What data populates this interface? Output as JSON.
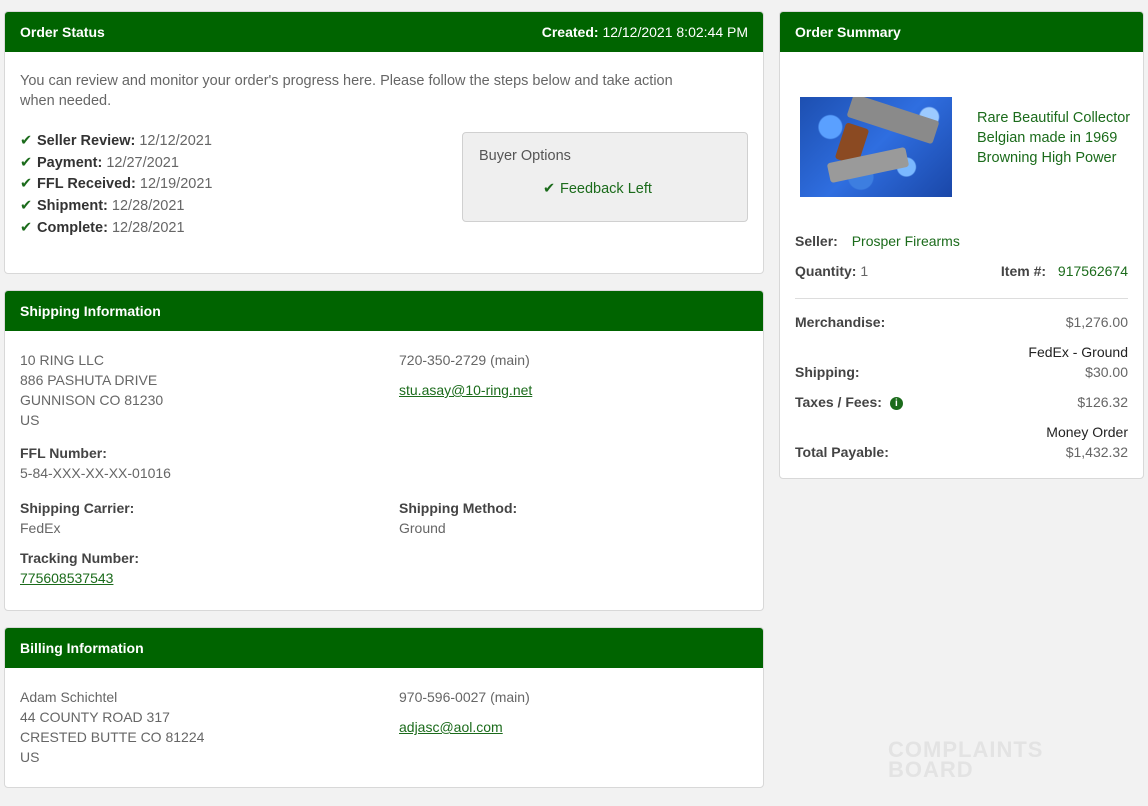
{
  "order_status": {
    "title": "Order Status",
    "created_label": "Created:",
    "created_value": "12/12/2021 8:02:44 PM",
    "intro": "You can review and monitor your order's progress here. Please follow the steps below and take action when needed.",
    "steps": [
      {
        "label": "Seller Review:",
        "value": "12/12/2021"
      },
      {
        "label": "Payment:",
        "value": "12/27/2021"
      },
      {
        "label": "FFL Received:",
        "value": "12/19/2021"
      },
      {
        "label": "Shipment:",
        "value": "12/28/2021"
      },
      {
        "label": "Complete:",
        "value": "12/28/2021"
      }
    ],
    "buyer_options": {
      "title": "Buyer Options",
      "feedback": "Feedback Left"
    }
  },
  "shipping": {
    "title": "Shipping Information",
    "address": [
      "10 RING LLC",
      "886 PASHUTA DRIVE",
      "GUNNISON CO 81230",
      "US"
    ],
    "phone": "720-350-2729 (main)",
    "email": "stu.asay@10-ring.net",
    "ffl_label": "FFL Number:",
    "ffl_value": "5-84-XXX-XX-XX-01016",
    "carrier_label": "Shipping Carrier:",
    "carrier_value": "FedEx",
    "method_label": "Shipping Method:",
    "method_value": "Ground",
    "tracking_label": "Tracking Number:",
    "tracking_value": "775608537543"
  },
  "billing": {
    "title": "Billing Information",
    "address": [
      "Adam Schichtel",
      "44 COUNTY ROAD 317",
      "CRESTED BUTTE CO 81224",
      "US"
    ],
    "phone": "970-596-0027 (main)",
    "email": "adjasc@aol.com"
  },
  "summary": {
    "title": "Order Summary",
    "item_title": "Rare Beautiful Collector Belgian made in 1969 Browning High Power",
    "seller_label": "Seller:",
    "seller_value": "Prosper Firearms",
    "quantity_label": "Quantity:",
    "quantity_value": "1",
    "item_no_label": "Item #:",
    "item_no_value": "917562674",
    "merch_label": "Merchandise:",
    "merch_value": "$1,276.00",
    "shipping_method": "FedEx - Ground",
    "shipping_label": "Shipping:",
    "shipping_value": "$30.00",
    "taxes_label": "Taxes / Fees:",
    "taxes_value": "$126.32",
    "payment_method": "Money Order",
    "total_label": "Total Payable:",
    "total_value": "$1,432.32"
  },
  "icons": {
    "check": "check-icon",
    "info": "info-icon"
  },
  "colors": {
    "header": "#006400",
    "accent": "#1b6b1b"
  }
}
